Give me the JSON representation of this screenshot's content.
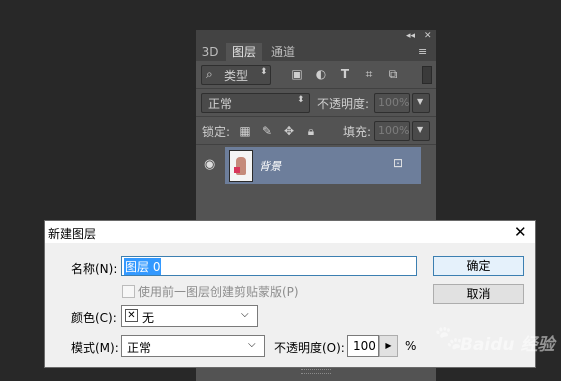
{
  "panel": {
    "collapse_icon": "◂◂",
    "close_icon": "✕",
    "menu_icon": "≡",
    "tabs": [
      {
        "label": "3D"
      },
      {
        "label": "图层"
      },
      {
        "label": "通道"
      }
    ],
    "filter_select": "类型",
    "blend_mode": "正常",
    "opacity_label": "不透明度:",
    "opacity_value": "100%",
    "lock_label": "锁定:",
    "fill_label": "填充:",
    "fill_value": "100%",
    "layer_name": "背景"
  },
  "dialog": {
    "title": "新建图层",
    "name_label": "名称(N):",
    "name_value": "图层 0",
    "clip_checkbox_label": "使用前一图层创建剪贴蒙版(P)",
    "color_label": "颜色(C):",
    "color_value": "无",
    "mode_label": "模式(M):",
    "mode_value": "正常",
    "opacity_label": "不透明度(O):",
    "opacity_value": "100",
    "opacity_unit": "%",
    "ok_button": "确定",
    "cancel_button": "取消"
  },
  "watermark": "Baidu 经验"
}
